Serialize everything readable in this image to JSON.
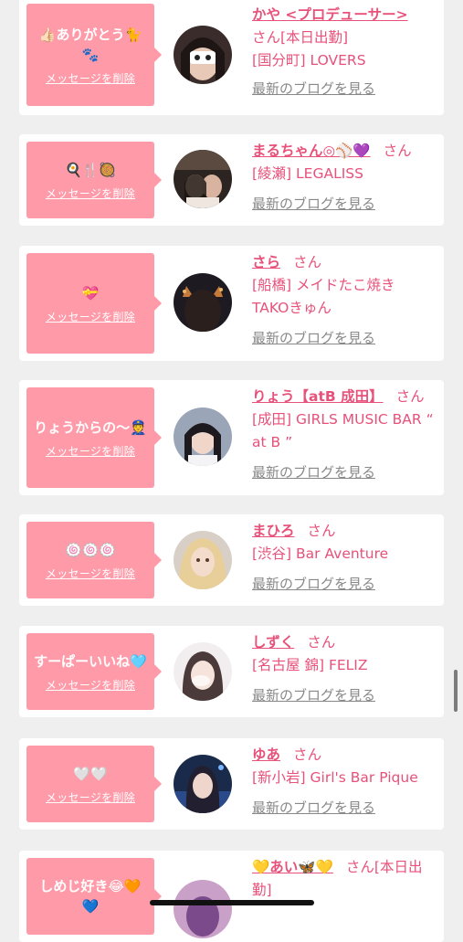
{
  "delete_label": "メッセージを削除",
  "blog_label": "最新のブログを見る",
  "san_label": "さん",
  "colors": {
    "bubble": "#ff9aa9",
    "accent": "#e8517a",
    "background": "#efefef",
    "card": "#ffffff",
    "muted": "#888888"
  },
  "entries": [
    {
      "message": "👍🏻ありがとう🐈🐾",
      "name": "かや <プロデューサー>",
      "name_suffix": "さん[本日出勤]",
      "shop": "[国分町] LOVERS",
      "avatar_icon": "avatar-photo"
    },
    {
      "message": "🍳🍴🥘",
      "name": "まるちゃん◎⚾💜",
      "shop": "[綾瀬] LEGALISS",
      "avatar_icon": "avatar-photo"
    },
    {
      "message": "💝",
      "name": "さら",
      "shop": "[船橋] メイドたこ焼きTAKOきゅん",
      "avatar_icon": "avatar-photo"
    },
    {
      "message": "りょうからの〜👮",
      "name": "りょう【atB 成田】",
      "shop": "[成田] GIRLS MUSIC BAR “ at B ”",
      "avatar_icon": "avatar-photo"
    },
    {
      "message": "🍥🍥🍥",
      "name": "まひろ",
      "shop": "[渋谷] Bar Aventure",
      "avatar_icon": "avatar-photo"
    },
    {
      "message": "すーぱーいいね🩵",
      "name": "しずく",
      "shop": "[名古屋 錦] FELIZ",
      "avatar_icon": "avatar-photo"
    },
    {
      "message": "🤍🤍",
      "name": "ゆあ",
      "shop": "[新小岩] Girl's Bar Pique",
      "avatar_icon": "avatar-photo"
    },
    {
      "message": "しめじ好き😂🧡💙",
      "name": "💛あい🦋💛",
      "name_suffix": "さん[本日出勤]",
      "shop": "",
      "avatar_icon": "avatar-photo"
    }
  ]
}
